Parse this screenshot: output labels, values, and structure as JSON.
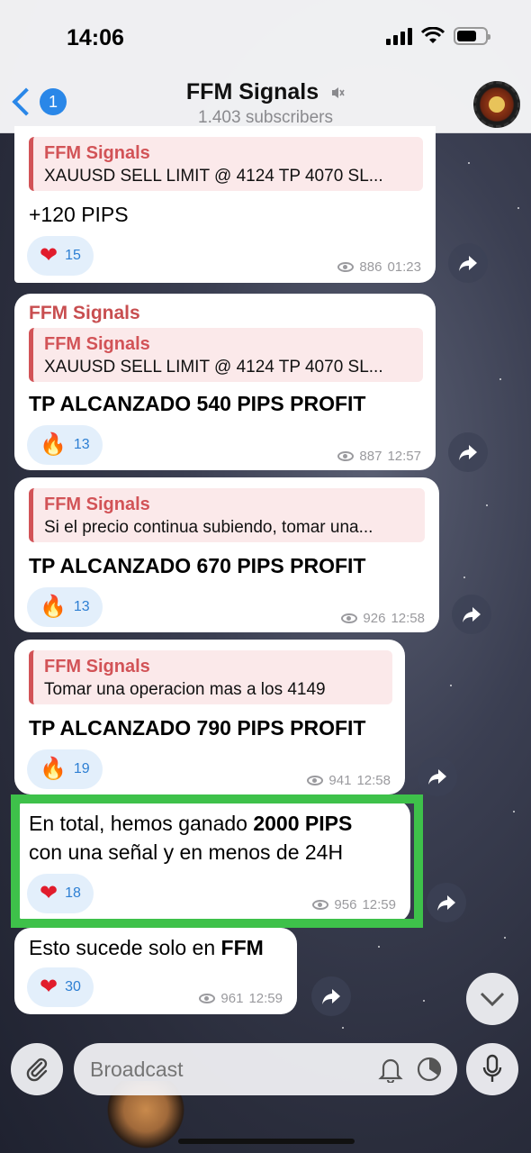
{
  "status_bar": {
    "time": "14:06"
  },
  "header": {
    "back_badge": "1",
    "title": "FFM Signals",
    "subtitle": "1.403 subscribers",
    "mute_icon": "speaker-muted-icon"
  },
  "messages": [
    {
      "reply": {
        "name": "FFM Signals",
        "text": "XAUUSD SELL LIMIT @ 4124 TP 4070 SL..."
      },
      "text": "+120 PIPS",
      "reaction": {
        "emoji": "❤",
        "icon": "heart-icon",
        "count": "15"
      },
      "views": "886",
      "time": "01:23"
    },
    {
      "sender": "FFM Signals",
      "reply": {
        "name": "FFM Signals",
        "text": "XAUUSD SELL LIMIT @ 4124 TP 4070 SL..."
      },
      "text": "TP ALCANZADO 540 PIPS PROFIT",
      "reaction": {
        "emoji": "🔥",
        "icon": "fire-icon",
        "count": "13"
      },
      "views": "887",
      "time": "12:57"
    },
    {
      "reply": {
        "name": "FFM Signals",
        "text": "Si el precio continua subiendo, tomar una..."
      },
      "text": "TP ALCANZADO 670 PIPS PROFIT",
      "reaction": {
        "emoji": "🔥",
        "icon": "fire-icon",
        "count": "13"
      },
      "views": "926",
      "time": "12:58"
    },
    {
      "reply": {
        "name": "FFM Signals",
        "text": "Tomar una operacion mas a los 4149"
      },
      "text": "TP ALCANZADO 790 PIPS PROFIT",
      "reaction": {
        "emoji": "🔥",
        "icon": "fire-icon",
        "count": "19"
      },
      "views": "941",
      "time": "12:58"
    },
    {
      "text_parts": [
        "En total, hemos ganado ",
        "2000 PIPS",
        "con una señal y en menos de 24H"
      ],
      "reaction": {
        "emoji": "❤",
        "icon": "heart-icon",
        "count": "18"
      },
      "views": "956",
      "time": "12:59"
    },
    {
      "text_parts": [
        "Esto sucede solo en ",
        "FFM"
      ],
      "reaction": {
        "emoji": "❤",
        "icon": "heart-icon",
        "count": "30"
      },
      "views": "961",
      "time": "12:59"
    }
  ],
  "input": {
    "placeholder": "Broadcast"
  },
  "colors": {
    "accent": "#2a87e8",
    "reply_name": "#d25357",
    "highlight": "#3ec14a"
  }
}
